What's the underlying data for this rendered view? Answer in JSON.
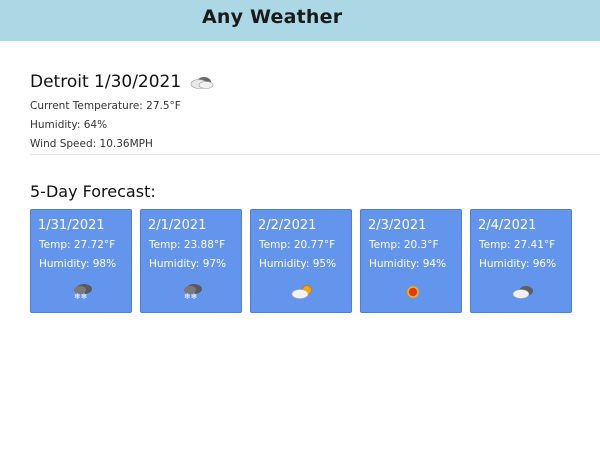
{
  "app": {
    "title": "Any Weather"
  },
  "current": {
    "city_date": "Detroit 1/30/2021",
    "icon": "overcast-cloud-icon",
    "temperature": "Current Temperature: 27.5°F",
    "humidity": "Humidity: 64%",
    "wind": "Wind Speed: 10.36MPH"
  },
  "forecast": {
    "title": "5-Day Forecast:",
    "days": [
      {
        "date": "1/31/2021",
        "temp": "Temp: 27.72°F",
        "humidity": "Humidity: 98%",
        "icon": "snow-icon"
      },
      {
        "date": "2/1/2021",
        "temp": "Temp: 23.88°F",
        "humidity": "Humidity: 97%",
        "icon": "snow-icon"
      },
      {
        "date": "2/2/2021",
        "temp": "Temp: 20.77°F",
        "humidity": "Humidity: 95%",
        "icon": "partly-cloudy-icon"
      },
      {
        "date": "2/3/2021",
        "temp": "Temp: 20.3°F",
        "humidity": "Humidity: 94%",
        "icon": "sun-icon"
      },
      {
        "date": "2/4/2021",
        "temp": "Temp: 27.41°F",
        "humidity": "Humidity: 96%",
        "icon": "overcast-cloud-icon"
      }
    ]
  },
  "colors": {
    "header_bg": "#acd8e5",
    "card_bg": "#6495ed"
  }
}
